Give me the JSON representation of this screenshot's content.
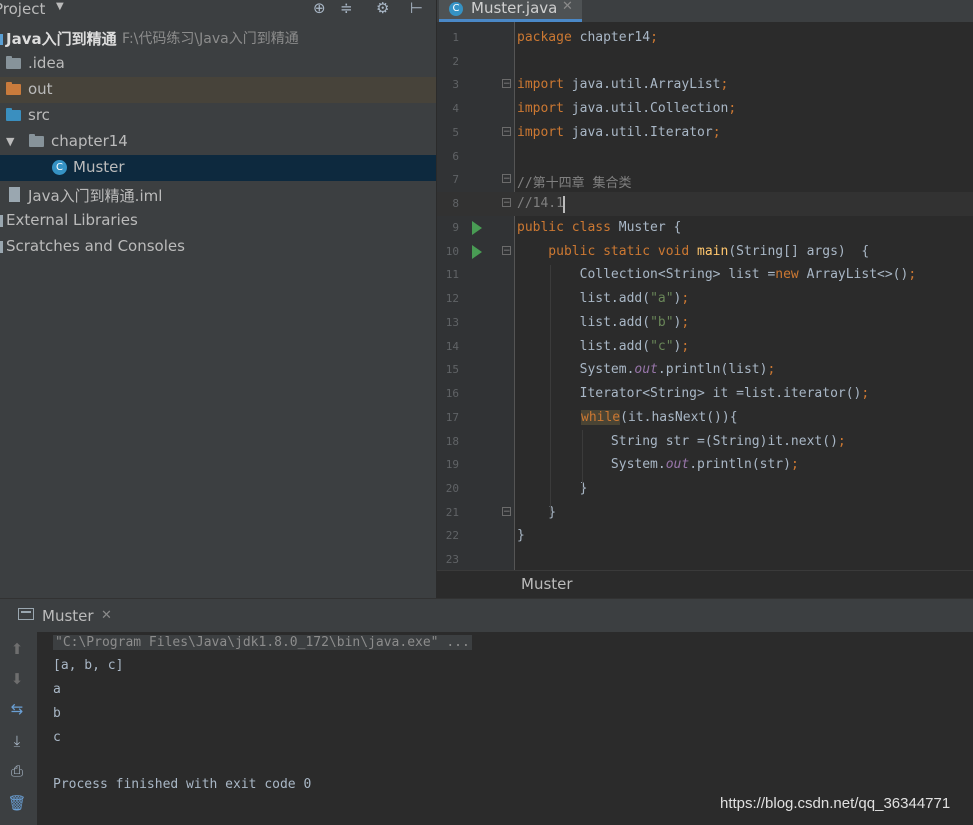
{
  "project": {
    "title": "Project",
    "tree": [
      {
        "label": "Java入门到精通",
        "path": "F:\\代码练习\\Java入门到精通"
      },
      {
        "label": ".idea"
      },
      {
        "label": "out"
      },
      {
        "label": "src"
      },
      {
        "label": "chapter14"
      },
      {
        "label": "Muster"
      },
      {
        "label": "Java入门到精通.iml"
      },
      {
        "label": "External Libraries"
      },
      {
        "label": "Scratches and Consoles"
      }
    ]
  },
  "editor": {
    "tab_name": "Muster.java",
    "breadcrumb": "Muster",
    "lines": [
      {
        "n": "1"
      },
      {
        "n": "2"
      },
      {
        "n": "3"
      },
      {
        "n": "4"
      },
      {
        "n": "5"
      },
      {
        "n": "6"
      },
      {
        "n": "7"
      },
      {
        "n": "8"
      },
      {
        "n": "9"
      },
      {
        "n": "10"
      },
      {
        "n": "11"
      },
      {
        "n": "12"
      },
      {
        "n": "13"
      },
      {
        "n": "14"
      },
      {
        "n": "15"
      },
      {
        "n": "16"
      },
      {
        "n": "17"
      },
      {
        "n": "18"
      },
      {
        "n": "19"
      },
      {
        "n": "20"
      },
      {
        "n": "21"
      },
      {
        "n": "22"
      },
      {
        "n": "23"
      }
    ],
    "code": {
      "l1": [
        "package",
        " chapter14",
        ";"
      ],
      "l3": [
        "import",
        " java.util.ArrayList",
        ";"
      ],
      "l4": [
        "import",
        " java.util.Collection",
        ";"
      ],
      "l5": [
        "import",
        " java.util.Iterator",
        ";"
      ],
      "l7": "//第十四章 集合类",
      "l8": "//14.1",
      "l9": [
        "public class",
        " Muster {"
      ],
      "l10": [
        "    public static void",
        " main",
        "(String[] args)  {"
      ],
      "l11": [
        "        Collection<String> list =",
        "new",
        " ArrayList<>()",
        ";"
      ],
      "l12": [
        "        list.add(",
        "\"a\"",
        ")",
        ";"
      ],
      "l13": [
        "        list.add(",
        "\"b\"",
        ")",
        ";"
      ],
      "l14": [
        "        list.add(",
        "\"c\"",
        ")",
        ";"
      ],
      "l15": [
        "        System.",
        "out",
        ".println(list)",
        ";"
      ],
      "l16": [
        "        Iterator<String> it =list.iterator()",
        ";"
      ],
      "l17": [
        "while",
        "(it.hasNext()){"
      ],
      "l18": [
        "            String str =(String)it.next()",
        ";"
      ],
      "l19": [
        "            System.",
        "out",
        ".println(str)",
        ";"
      ],
      "l20": "        }",
      "l21": "    }",
      "l22": "}"
    }
  },
  "run": {
    "tab_label": "Muster",
    "console": {
      "cmd": "\"C:\\Program Files\\Java\\jdk1.8.0_172\\bin\\java.exe\" ...",
      "out1": "[a, b, c]",
      "out2": "a",
      "out3": "b",
      "out4": "c",
      "exit": "Process finished with exit code 0"
    }
  },
  "watermark": "https://blog.csdn.net/qq_36344771",
  "colors": {
    "keyword": "#cc7832",
    "string": "#6a8759",
    "field": "#9876aa",
    "method": "#ffc66d",
    "comment": "#808080",
    "accent": "#4a88c7",
    "selection": "#0d293e"
  }
}
